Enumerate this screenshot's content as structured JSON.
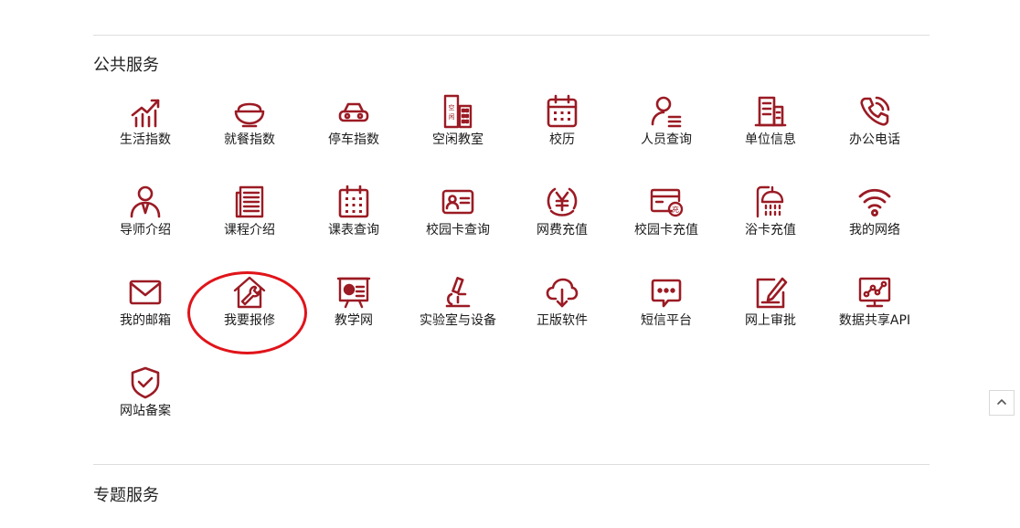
{
  "accent_color": "#9b1b24",
  "annotation_color": "#e0141a",
  "sections": {
    "public": {
      "title": "公共服务",
      "items": [
        {
          "label": "生活指数",
          "icon": "chart-trend-icon"
        },
        {
          "label": "就餐指数",
          "icon": "rice-bowl-icon"
        },
        {
          "label": "停车指数",
          "icon": "car-icon"
        },
        {
          "label": "空闲教室",
          "icon": "building-free-icon"
        },
        {
          "label": "校历",
          "icon": "calendar-icon"
        },
        {
          "label": "人员查询",
          "icon": "person-search-icon"
        },
        {
          "label": "单位信息",
          "icon": "office-building-icon"
        },
        {
          "label": "办公电话",
          "icon": "phone-icon"
        },
        {
          "label": "导师介绍",
          "icon": "tutor-icon"
        },
        {
          "label": "课程介绍",
          "icon": "document-icon"
        },
        {
          "label": "课表查询",
          "icon": "schedule-icon"
        },
        {
          "label": "校园卡查询",
          "icon": "id-card-icon"
        },
        {
          "label": "网费充值",
          "icon": "yuan-coin-icon"
        },
        {
          "label": "校园卡充值",
          "icon": "card-recharge-icon"
        },
        {
          "label": "浴卡充值",
          "icon": "shower-icon"
        },
        {
          "label": "我的网络",
          "icon": "wifi-icon"
        },
        {
          "label": "我的邮箱",
          "icon": "mail-icon"
        },
        {
          "label": "我要报修",
          "icon": "house-wrench-icon"
        },
        {
          "label": "教学网",
          "icon": "presentation-icon"
        },
        {
          "label": "实验室与设备",
          "icon": "microscope-icon"
        },
        {
          "label": "正版软件",
          "icon": "cloud-download-icon"
        },
        {
          "label": "短信平台",
          "icon": "chat-bubble-icon"
        },
        {
          "label": "网上审批",
          "icon": "approval-edit-icon"
        },
        {
          "label": "数据共享API",
          "icon": "data-monitor-icon"
        },
        {
          "label": "网站备案",
          "icon": "shield-check-icon"
        }
      ]
    },
    "special": {
      "title": "专题服务"
    }
  }
}
